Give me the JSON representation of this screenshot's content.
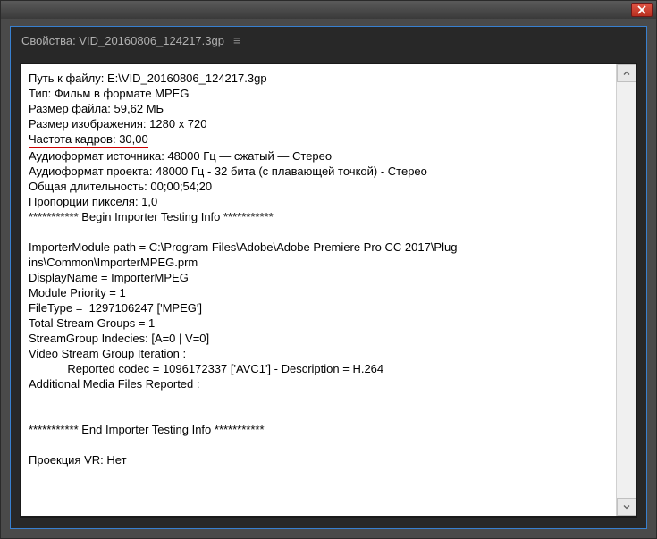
{
  "window": {
    "title": "Свойства: VID_20160806_124217.3gp"
  },
  "properties": {
    "file_path_label": "Путь к файлу:",
    "file_path_value": "E:\\VID_20160806_124217.3gp",
    "type_label": "Тип:",
    "type_value": "Фильм в формате MPEG",
    "file_size_label": "Размер файла:",
    "file_size_value": "59,62 МБ",
    "image_size_label": "Размер изображения:",
    "image_size_value": "1280 x 720",
    "frame_rate_label": "Частота кадров:",
    "frame_rate_value": "30,00",
    "source_audio_label": "Аудиоформат источника:",
    "source_audio_value": "48000 Гц — сжатый — Стерео",
    "project_audio_label": "Аудиоформат проекта:",
    "project_audio_value": "48000 Гц - 32 бита (с плавающей точкой) - Стерео",
    "duration_label": "Общая длительность:",
    "duration_value": "00;00;54;20",
    "pixel_aspect_label": "Пропорции пикселя:",
    "pixel_aspect_value": "1,0",
    "begin_marker": "*********** Begin Importer Testing Info ***********",
    "importer_path_label": "ImporterModule path =",
    "importer_path_value": "C:\\Program Files\\Adobe\\Adobe Premiere Pro CC 2017\\Plug-ins\\Common\\ImporterMPEG.prm",
    "display_name_label": "DisplayName =",
    "display_name_value": "ImporterMPEG",
    "module_priority_label": "Module Priority =",
    "module_priority_value": "1",
    "file_type_label": "FileType = ",
    "file_type_value": "1297106247 ['MPEG']",
    "total_stream_label": "Total Stream Groups =",
    "total_stream_value": "1",
    "stream_index_label": "StreamGroup Indecies:",
    "stream_index_value": "[A=0 | V=0]",
    "video_stream_label": "Video Stream Group Iteration :",
    "reported_codec_label": "            Reported codec =",
    "reported_codec_value": "1096172337 ['AVC1'] - Description = H.264",
    "additional_media_label": "Additional Media Files Reported :",
    "end_marker": "*********** End Importer Testing Info ***********",
    "vr_label": "Проекция VR:",
    "vr_value": "Нет"
  }
}
